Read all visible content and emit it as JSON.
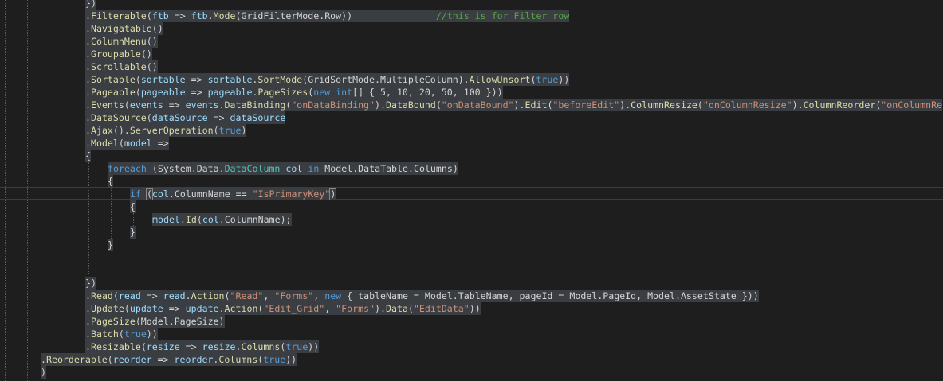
{
  "editor": {
    "lines": [
      {
        "indent": 107,
        "tokens": [
          {
            "t": "})",
            "c": "#d4d4d4"
          }
        ]
      },
      {
        "indent": 107,
        "tokens": [
          {
            "t": ".",
            "c": "#d4d4d4"
          },
          {
            "t": "Filterable",
            "c": "#dcdcaa"
          },
          {
            "t": "(",
            "c": "#d4d4d4"
          },
          {
            "t": "ftb",
            "c": "#9cdcfe"
          },
          {
            "t": " => ",
            "c": "#d4d4d4"
          },
          {
            "t": "ftb",
            "c": "#9cdcfe"
          },
          {
            "t": ".",
            "c": "#d4d4d4"
          },
          {
            "t": "Mode",
            "c": "#dcdcaa"
          },
          {
            "t": "(GridFilterMode.Row))",
            "c": "#d4d4d4"
          },
          {
            "t": "               ",
            "c": "#d4d4d4"
          },
          {
            "t": "//this is for Filter row",
            "c": "#57a64a"
          }
        ]
      },
      {
        "indent": 107,
        "tokens": [
          {
            "t": ".",
            "c": "#d4d4d4"
          },
          {
            "t": "Navigatable",
            "c": "#dcdcaa"
          },
          {
            "t": "()",
            "c": "#d4d4d4"
          }
        ]
      },
      {
        "indent": 107,
        "tokens": [
          {
            "t": ".",
            "c": "#d4d4d4"
          },
          {
            "t": "ColumnMenu",
            "c": "#dcdcaa"
          },
          {
            "t": "()",
            "c": "#d4d4d4"
          }
        ]
      },
      {
        "indent": 107,
        "tokens": [
          {
            "t": ".",
            "c": "#d4d4d4"
          },
          {
            "t": "Groupable",
            "c": "#dcdcaa"
          },
          {
            "t": "()",
            "c": "#d4d4d4"
          }
        ]
      },
      {
        "indent": 107,
        "tokens": [
          {
            "t": ".",
            "c": "#d4d4d4"
          },
          {
            "t": "Scrollable",
            "c": "#dcdcaa"
          },
          {
            "t": "()",
            "c": "#d4d4d4"
          }
        ]
      },
      {
        "indent": 107,
        "tokens": [
          {
            "t": ".",
            "c": "#d4d4d4"
          },
          {
            "t": "Sortable",
            "c": "#dcdcaa"
          },
          {
            "t": "(",
            "c": "#d4d4d4"
          },
          {
            "t": "sortable",
            "c": "#9cdcfe"
          },
          {
            "t": " => ",
            "c": "#d4d4d4"
          },
          {
            "t": "sortable",
            "c": "#9cdcfe"
          },
          {
            "t": ".",
            "c": "#d4d4d4"
          },
          {
            "t": "SortMode",
            "c": "#dcdcaa"
          },
          {
            "t": "(GridSortMode.MultipleColumn).",
            "c": "#d4d4d4"
          },
          {
            "t": "AllowUnsort",
            "c": "#dcdcaa"
          },
          {
            "t": "(",
            "c": "#d4d4d4"
          },
          {
            "t": "true",
            "c": "#569cd6"
          },
          {
            "t": "))",
            "c": "#d4d4d4"
          }
        ]
      },
      {
        "indent": 107,
        "tokens": [
          {
            "t": ".",
            "c": "#d4d4d4"
          },
          {
            "t": "Pageable",
            "c": "#dcdcaa"
          },
          {
            "t": "(",
            "c": "#d4d4d4"
          },
          {
            "t": "pageable",
            "c": "#9cdcfe"
          },
          {
            "t": " => ",
            "c": "#d4d4d4"
          },
          {
            "t": "pageable",
            "c": "#9cdcfe"
          },
          {
            "t": ".",
            "c": "#d4d4d4"
          },
          {
            "t": "PageSizes",
            "c": "#dcdcaa"
          },
          {
            "t": "(",
            "c": "#d4d4d4"
          },
          {
            "t": "new",
            "c": "#569cd6"
          },
          {
            "t": " ",
            "c": "#d4d4d4"
          },
          {
            "t": "int",
            "c": "#569cd6"
          },
          {
            "t": "[] { 5, 10, 20, 50, 100 }))",
            "c": "#d4d4d4"
          }
        ]
      },
      {
        "indent": 107,
        "tokens": [
          {
            "t": ".",
            "c": "#d4d4d4"
          },
          {
            "t": "Events",
            "c": "#dcdcaa"
          },
          {
            "t": "(",
            "c": "#d4d4d4"
          },
          {
            "t": "events",
            "c": "#9cdcfe"
          },
          {
            "t": " => ",
            "c": "#d4d4d4"
          },
          {
            "t": "events",
            "c": "#9cdcfe"
          },
          {
            "t": ".",
            "c": "#d4d4d4"
          },
          {
            "t": "DataBinding",
            "c": "#dcdcaa"
          },
          {
            "t": "(",
            "c": "#d4d4d4"
          },
          {
            "t": "\"onDataBinding\"",
            "c": "#ce9178"
          },
          {
            "t": ").",
            "c": "#d4d4d4"
          },
          {
            "t": "DataBound",
            "c": "#dcdcaa"
          },
          {
            "t": "(",
            "c": "#d4d4d4"
          },
          {
            "t": "\"onDataBound\"",
            "c": "#ce9178"
          },
          {
            "t": ").",
            "c": "#d4d4d4"
          },
          {
            "t": "Edit",
            "c": "#dcdcaa"
          },
          {
            "t": "(",
            "c": "#d4d4d4"
          },
          {
            "t": "\"beforeEdit\"",
            "c": "#ce9178"
          },
          {
            "t": ").",
            "c": "#d4d4d4"
          },
          {
            "t": "ColumnResize",
            "c": "#dcdcaa"
          },
          {
            "t": "(",
            "c": "#d4d4d4"
          },
          {
            "t": "\"onColumnResize\"",
            "c": "#ce9178"
          },
          {
            "t": ").",
            "c": "#d4d4d4"
          },
          {
            "t": "ColumnReorder",
            "c": "#dcdcaa"
          },
          {
            "t": "(",
            "c": "#d4d4d4"
          },
          {
            "t": "\"onColumnRe",
            "c": "#ce9178"
          }
        ]
      },
      {
        "indent": 107,
        "tokens": [
          {
            "t": ".",
            "c": "#d4d4d4"
          },
          {
            "t": "DataSource",
            "c": "#dcdcaa"
          },
          {
            "t": "(",
            "c": "#d4d4d4"
          },
          {
            "t": "dataSource",
            "c": "#9cdcfe"
          },
          {
            "t": " => ",
            "c": "#d4d4d4"
          },
          {
            "t": "dataSource",
            "c": "#9cdcfe"
          }
        ]
      },
      {
        "indent": 107,
        "tokens": [
          {
            "t": ".",
            "c": "#d4d4d4"
          },
          {
            "t": "Ajax",
            "c": "#dcdcaa"
          },
          {
            "t": "().",
            "c": "#d4d4d4"
          },
          {
            "t": "ServerOperation",
            "c": "#dcdcaa"
          },
          {
            "t": "(",
            "c": "#d4d4d4"
          },
          {
            "t": "true",
            "c": "#569cd6"
          },
          {
            "t": ")",
            "c": "#d4d4d4"
          }
        ]
      },
      {
        "indent": 107,
        "tokens": [
          {
            "t": ".",
            "c": "#d4d4d4"
          },
          {
            "t": "Model",
            "c": "#dcdcaa"
          },
          {
            "t": "(",
            "c": "#d4d4d4"
          },
          {
            "t": "model",
            "c": "#9cdcfe"
          },
          {
            "t": " =>",
            "c": "#d4d4d4"
          }
        ]
      },
      {
        "indent": 107,
        "tokens": [
          {
            "t": "{",
            "c": "#d4d4d4"
          }
        ]
      },
      {
        "indent": 135,
        "tokens": [
          {
            "t": "foreach",
            "c": "#569cd6"
          },
          {
            "t": " (System.Data.",
            "c": "#d4d4d4"
          },
          {
            "t": "DataColumn",
            "c": "#4ec9b0"
          },
          {
            "t": " ",
            "c": "#d4d4d4"
          },
          {
            "t": "col",
            "c": "#9cdcfe"
          },
          {
            "t": " ",
            "c": "#d4d4d4"
          },
          {
            "t": "in",
            "c": "#569cd6"
          },
          {
            "t": " Model.DataTable.Columns)",
            "c": "#d4d4d4"
          }
        ]
      },
      {
        "indent": 135,
        "tokens": [
          {
            "t": "{",
            "c": "#d4d4d4"
          }
        ]
      },
      {
        "indent": 163,
        "tokens": [
          {
            "t": "if",
            "c": "#569cd6"
          },
          {
            "t": " ",
            "c": "#d4d4d4"
          },
          {
            "t": "(",
            "c": "#d4d4d4",
            "box": true
          },
          {
            "t": "col",
            "c": "#9cdcfe"
          },
          {
            "t": ".ColumnName == ",
            "c": "#d4d4d4"
          },
          {
            "t": "\"IsPrimaryKey\"",
            "c": "#ce9178"
          },
          {
            "t": ")",
            "c": "#d4d4d4",
            "box": true
          }
        ]
      },
      {
        "indent": 163,
        "tokens": [
          {
            "t": "{",
            "c": "#d4d4d4"
          }
        ]
      },
      {
        "indent": 191,
        "tokens": [
          {
            "t": "model",
            "c": "#9cdcfe"
          },
          {
            "t": ".",
            "c": "#d4d4d4"
          },
          {
            "t": "Id",
            "c": "#dcdcaa"
          },
          {
            "t": "(",
            "c": "#d4d4d4"
          },
          {
            "t": "col",
            "c": "#9cdcfe"
          },
          {
            "t": ".ColumnName);",
            "c": "#d4d4d4"
          }
        ]
      },
      {
        "indent": 163,
        "tokens": [
          {
            "t": "}",
            "c": "#d4d4d4"
          }
        ]
      },
      {
        "indent": 135,
        "tokens": [
          {
            "t": "}",
            "c": "#d4d4d4"
          }
        ]
      },
      {
        "indent": 107,
        "tokens": []
      },
      {
        "indent": 107,
        "tokens": []
      },
      {
        "indent": 107,
        "tokens": [
          {
            "t": "})",
            "c": "#d4d4d4"
          }
        ]
      },
      {
        "indent": 107,
        "tokens": [
          {
            "t": ".",
            "c": "#d4d4d4"
          },
          {
            "t": "Read",
            "c": "#dcdcaa"
          },
          {
            "t": "(",
            "c": "#d4d4d4"
          },
          {
            "t": "read",
            "c": "#9cdcfe"
          },
          {
            "t": " => ",
            "c": "#d4d4d4"
          },
          {
            "t": "read",
            "c": "#9cdcfe"
          },
          {
            "t": ".",
            "c": "#d4d4d4"
          },
          {
            "t": "Action",
            "c": "#dcdcaa"
          },
          {
            "t": "(",
            "c": "#d4d4d4"
          },
          {
            "t": "\"Read\"",
            "c": "#ce9178"
          },
          {
            "t": ", ",
            "c": "#d4d4d4"
          },
          {
            "t": "\"Forms\"",
            "c": "#ce9178"
          },
          {
            "t": ", ",
            "c": "#d4d4d4"
          },
          {
            "t": "new",
            "c": "#569cd6"
          },
          {
            "t": " { tableName = Model.TableName, pageId = Model.PageId, Model.AssetState }))",
            "c": "#d4d4d4"
          }
        ]
      },
      {
        "indent": 107,
        "tokens": [
          {
            "t": ".",
            "c": "#d4d4d4"
          },
          {
            "t": "Update",
            "c": "#dcdcaa"
          },
          {
            "t": "(",
            "c": "#d4d4d4"
          },
          {
            "t": "update",
            "c": "#9cdcfe"
          },
          {
            "t": " => ",
            "c": "#d4d4d4"
          },
          {
            "t": "update",
            "c": "#9cdcfe"
          },
          {
            "t": ".",
            "c": "#d4d4d4"
          },
          {
            "t": "Action",
            "c": "#dcdcaa"
          },
          {
            "t": "(",
            "c": "#d4d4d4"
          },
          {
            "t": "\"Edit_Grid\"",
            "c": "#ce9178"
          },
          {
            "t": ", ",
            "c": "#d4d4d4"
          },
          {
            "t": "\"Forms\"",
            "c": "#ce9178"
          },
          {
            "t": ").",
            "c": "#d4d4d4"
          },
          {
            "t": "Data",
            "c": "#dcdcaa"
          },
          {
            "t": "(",
            "c": "#d4d4d4"
          },
          {
            "t": "\"EditData\"",
            "c": "#ce9178"
          },
          {
            "t": "))",
            "c": "#d4d4d4"
          }
        ]
      },
      {
        "indent": 107,
        "tokens": [
          {
            "t": ".",
            "c": "#d4d4d4"
          },
          {
            "t": "PageSize",
            "c": "#dcdcaa"
          },
          {
            "t": "(Model.PageSize)",
            "c": "#d4d4d4"
          }
        ]
      },
      {
        "indent": 107,
        "tokens": [
          {
            "t": ".",
            "c": "#d4d4d4"
          },
          {
            "t": "Batch",
            "c": "#dcdcaa"
          },
          {
            "t": "(",
            "c": "#d4d4d4"
          },
          {
            "t": "true",
            "c": "#569cd6"
          },
          {
            "t": "))",
            "c": "#d4d4d4"
          }
        ]
      },
      {
        "indent": 107,
        "tokens": [
          {
            "t": ".",
            "c": "#d4d4d4"
          },
          {
            "t": "Resizable",
            "c": "#dcdcaa"
          },
          {
            "t": "(",
            "c": "#d4d4d4"
          },
          {
            "t": "resize",
            "c": "#9cdcfe"
          },
          {
            "t": " => ",
            "c": "#d4d4d4"
          },
          {
            "t": "resize",
            "c": "#9cdcfe"
          },
          {
            "t": ".",
            "c": "#d4d4d4"
          },
          {
            "t": "Columns",
            "c": "#dcdcaa"
          },
          {
            "t": "(",
            "c": "#d4d4d4"
          },
          {
            "t": "true",
            "c": "#569cd6"
          },
          {
            "t": "))",
            "c": "#d4d4d4"
          }
        ]
      },
      {
        "indent": 51,
        "tokens": [
          {
            "t": ".",
            "c": "#d4d4d4"
          },
          {
            "t": "Reorderable",
            "c": "#dcdcaa"
          },
          {
            "t": "(",
            "c": "#d4d4d4"
          },
          {
            "t": "reorder",
            "c": "#9cdcfe"
          },
          {
            "t": " => ",
            "c": "#d4d4d4"
          },
          {
            "t": "reorder",
            "c": "#9cdcfe"
          },
          {
            "t": ".",
            "c": "#d4d4d4"
          },
          {
            "t": "Columns",
            "c": "#dcdcaa"
          },
          {
            "t": "(",
            "c": "#d4d4d4"
          },
          {
            "t": "true",
            "c": "#569cd6"
          },
          {
            "t": "))",
            "c": "#d4d4d4"
          }
        ]
      },
      {
        "indent": 51,
        "tokens": [
          {
            "t": ")",
            "c": "#d4d4d4"
          }
        ]
      }
    ]
  }
}
